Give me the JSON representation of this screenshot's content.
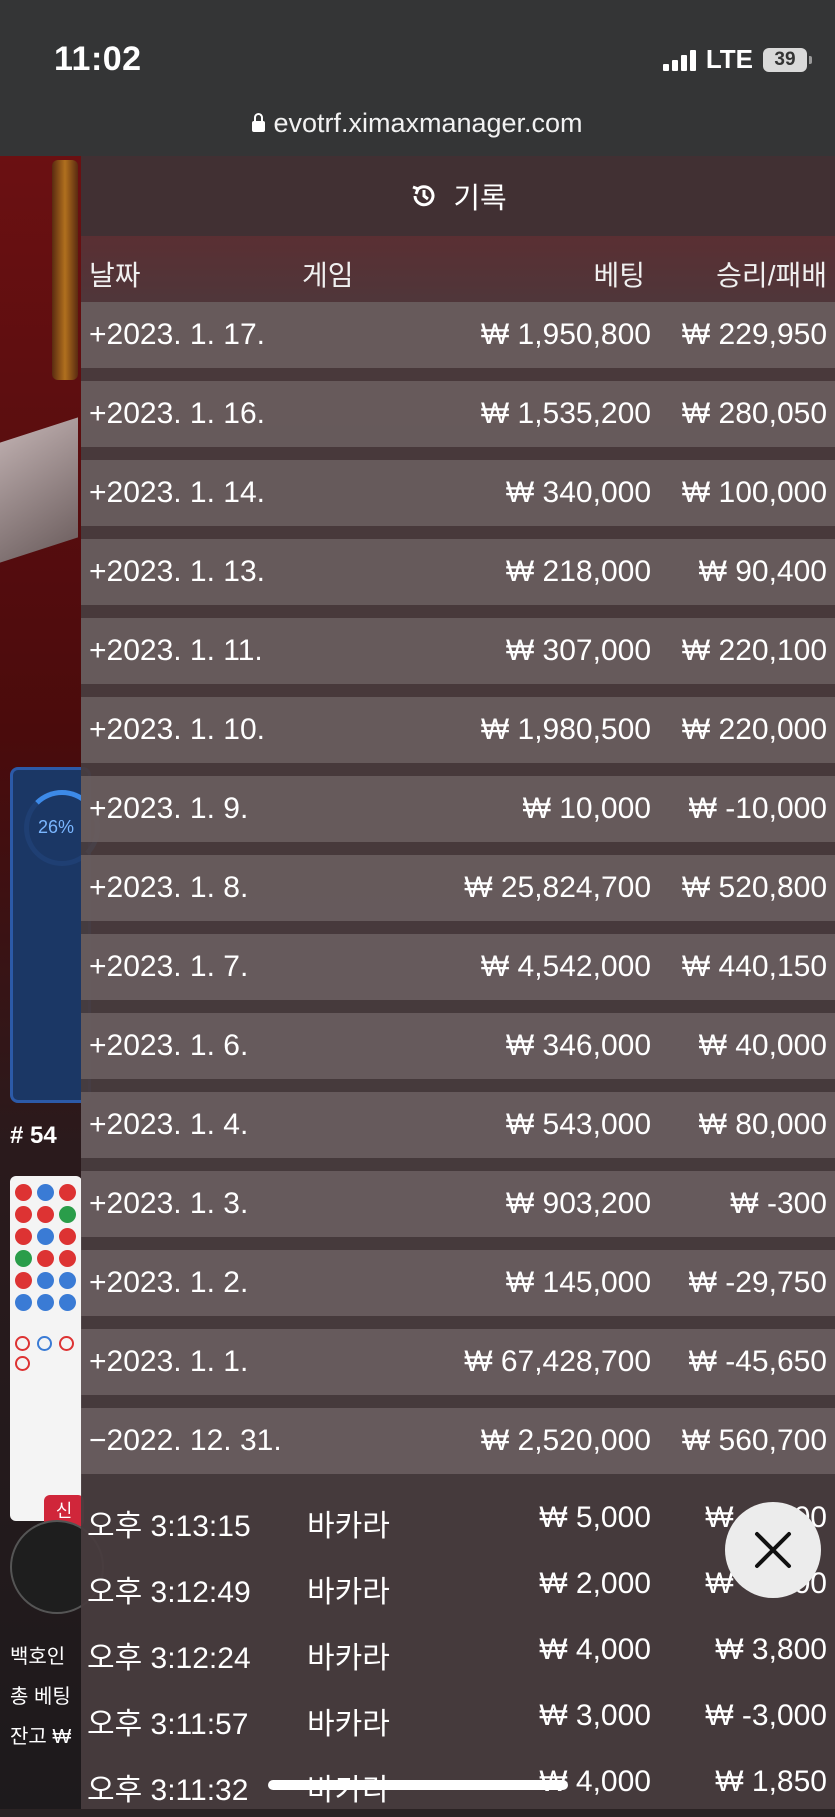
{
  "status_bar": {
    "time": "11:02",
    "network": "LTE",
    "battery": "39"
  },
  "browser": {
    "url": "evotrf.ximaxmanager.com"
  },
  "background": {
    "progress_label": "26%",
    "round_number": "# 54",
    "new_tag": "신",
    "line1": "백호인",
    "line2": "총 베팅",
    "line3": "잔고 ₩"
  },
  "history": {
    "title": "기록",
    "columns": {
      "date": "날짜",
      "game": "게임",
      "bet": "베팅",
      "win_loss": "승리/패배"
    },
    "days": [
      {
        "date": "+2023. 1. 17.",
        "bet": "₩ 1,950,800",
        "win_loss": "₩ 229,950"
      },
      {
        "date": "+2023. 1. 16.",
        "bet": "₩ 1,535,200",
        "win_loss": "₩ 280,050"
      },
      {
        "date": "+2023. 1. 14.",
        "bet": "₩ 340,000",
        "win_loss": "₩ 100,000"
      },
      {
        "date": "+2023. 1. 13.",
        "bet": "₩ 218,000",
        "win_loss": "₩ 90,400"
      },
      {
        "date": "+2023. 1. 11.",
        "bet": "₩ 307,000",
        "win_loss": "₩ 220,100"
      },
      {
        "date": "+2023. 1. 10.",
        "bet": "₩ 1,980,500",
        "win_loss": "₩ 220,000"
      },
      {
        "date": "+2023. 1. 9.",
        "bet": "₩ 10,000",
        "win_loss": "₩ -10,000"
      },
      {
        "date": "+2023. 1. 8.",
        "bet": "₩ 25,824,700",
        "win_loss": "₩ 520,800"
      },
      {
        "date": "+2023. 1. 7.",
        "bet": "₩ 4,542,000",
        "win_loss": "₩ 440,150"
      },
      {
        "date": "+2023. 1. 6.",
        "bet": "₩ 346,000",
        "win_loss": "₩ 40,000"
      },
      {
        "date": "+2023. 1. 4.",
        "bet": "₩ 543,000",
        "win_loss": "₩ 80,000"
      },
      {
        "date": "+2023. 1. 3.",
        "bet": "₩ 903,200",
        "win_loss": "₩ -300"
      },
      {
        "date": "+2023. 1. 2.",
        "bet": "₩ 145,000",
        "win_loss": "₩ -29,750"
      },
      {
        "date": "+2023. 1. 1.",
        "bet": "₩ 67,428,700",
        "win_loss": "₩ -45,650"
      },
      {
        "date": "−2022. 12. 31.",
        "bet": "₩ 2,520,000",
        "win_loss": "₩ 560,700"
      }
    ],
    "details": [
      {
        "time": "오후 3:13:15",
        "game": "바카라",
        "bet": "₩ 5,000",
        "win_loss": "₩ -5,000"
      },
      {
        "time": "오후 3:12:49",
        "game": "바카라",
        "bet": "₩ 2,000",
        "win_loss": "₩ -2,000"
      },
      {
        "time": "오후 3:12:24",
        "game": "바카라",
        "bet": "₩ 4,000",
        "win_loss": "₩ 3,800"
      },
      {
        "time": "오후 3:11:57",
        "game": "바카라",
        "bet": "₩ 3,000",
        "win_loss": "₩ -3,000"
      },
      {
        "time": "오후 3:11:32",
        "game": "바카라",
        "bet": "₩ 4,000",
        "win_loss": "₩ 1,850"
      }
    ]
  }
}
